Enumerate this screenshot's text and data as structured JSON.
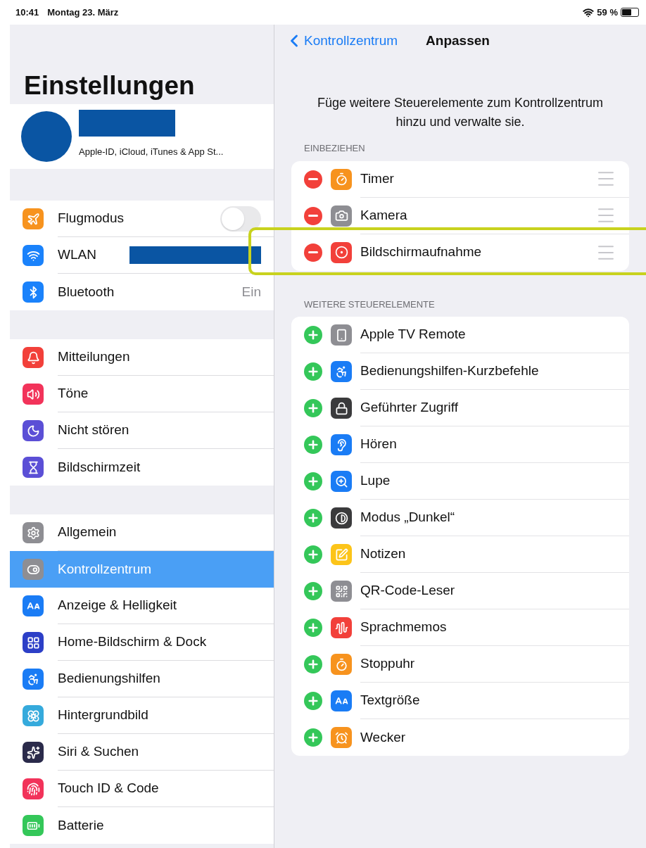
{
  "status_bar": {
    "time": "10:41",
    "date": "Montag 23. März",
    "battery": "59 %"
  },
  "sidebar": {
    "title": "Einstellungen",
    "profile": {
      "subtitle": "Apple-ID, iCloud, iTunes & App St..."
    },
    "groups": [
      {
        "items": [
          {
            "label": "Flugmodus",
            "color": "#f7931e",
            "kind": "toggle",
            "on": false
          },
          {
            "label": "WLAN",
            "color": "#1a82fb",
            "kind": "redacted"
          },
          {
            "label": "Bluetooth",
            "color": "#1a82fb",
            "kind": "value",
            "value": "Ein"
          }
        ]
      },
      {
        "items": [
          {
            "label": "Mitteilungen",
            "color": "#f2403a",
            "kind": "link",
            "selected": false
          },
          {
            "label": "Töne",
            "color": "#f2335a",
            "kind": "link",
            "selected": false
          },
          {
            "label": "Nicht stören",
            "color": "#5b4fd6",
            "kind": "link",
            "selected": false
          },
          {
            "label": "Bildschirmzeit",
            "color": "#5b4fd6",
            "kind": "link",
            "selected": false
          }
        ]
      },
      {
        "items": [
          {
            "label": "Allgemein",
            "color": "#8e8e93",
            "kind": "link",
            "selected": false
          },
          {
            "label": "Kontrollzentrum",
            "color": "#8e8e93",
            "kind": "link",
            "selected": true
          },
          {
            "label": "Anzeige & Helligkeit",
            "color": "#1a7cf5",
            "kind": "link",
            "selected": false
          },
          {
            "label": "Home-Bildschirm & Dock",
            "color": "#2c3fc7",
            "kind": "link",
            "selected": false
          },
          {
            "label": "Bedienungshilfen",
            "color": "#1a7cf5",
            "kind": "link",
            "selected": false
          },
          {
            "label": "Hintergrundbild",
            "color": "#35aadc",
            "kind": "link",
            "selected": false
          },
          {
            "label": "Siri & Suchen",
            "color": "#2a2a4a",
            "kind": "link",
            "selected": false
          },
          {
            "label": "Touch ID & Code",
            "color": "#f2335a",
            "kind": "link",
            "selected": false
          },
          {
            "label": "Batterie",
            "color": "#34c759",
            "kind": "link",
            "selected": false
          }
        ]
      }
    ]
  },
  "detail": {
    "back": "Kontrollzentrum",
    "title": "Anpassen",
    "description": "Füge weitere Steuerelemente zum Kontrollzentrum hinzu und verwalte sie.",
    "sections": [
      {
        "header": "EINBEZIEHEN",
        "kind": "included",
        "items": [
          {
            "label": "Timer",
            "color": "#f7931e",
            "highlighted": false
          },
          {
            "label": "Kamera",
            "color": "#8e8e93",
            "highlighted": false
          },
          {
            "label": "Bildschirmaufnahme",
            "color": "#f2403a",
            "highlighted": true
          }
        ]
      },
      {
        "header": "WEITERE STEUERELEMENTE",
        "kind": "available",
        "items": [
          {
            "label": "Apple TV Remote",
            "color": "#8e8e93"
          },
          {
            "label": "Bedienungshilfen-Kurzbefehle",
            "color": "#1a7cf5"
          },
          {
            "label": "Geführter Zugriff",
            "color": "#3a3a3c"
          },
          {
            "label": "Hören",
            "color": "#1a7cf5"
          },
          {
            "label": "Lupe",
            "color": "#1a7cf5"
          },
          {
            "label": "Modus „Dunkel“",
            "color": "#3a3a3c"
          },
          {
            "label": "Notizen",
            "color": "#fcc419"
          },
          {
            "label": "QR-Code-Leser",
            "color": "#8e8e93"
          },
          {
            "label": "Sprachmemos",
            "color": "#f2403a"
          },
          {
            "label": "Stoppuhr",
            "color": "#f7931e"
          },
          {
            "label": "Textgröße",
            "color": "#1a7cf5"
          },
          {
            "label": "Wecker",
            "color": "#f7931e"
          }
        ]
      }
    ]
  }
}
